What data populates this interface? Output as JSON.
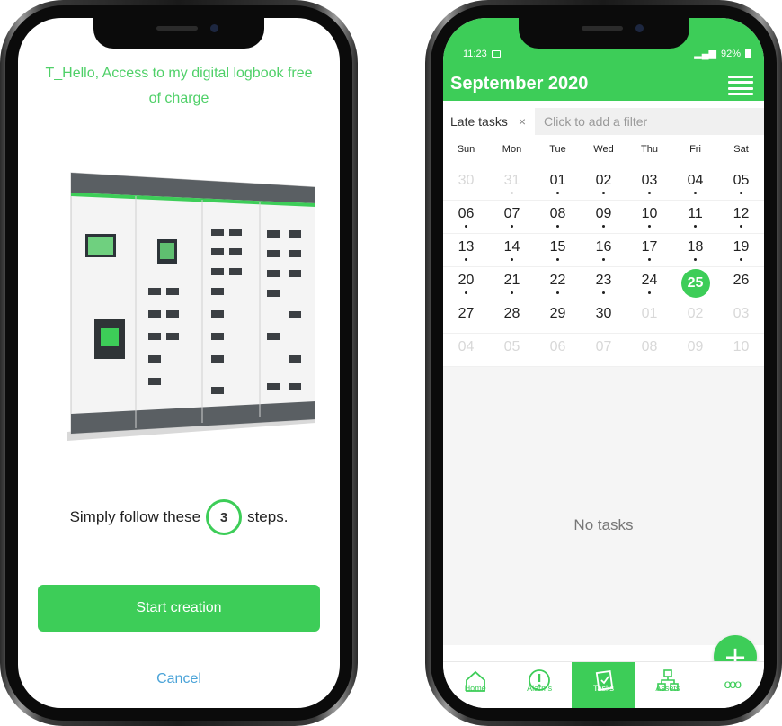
{
  "left_phone": {
    "title": "T_Hello, Access to my digital logbook free of charge",
    "steps_prefix": "Simply follow these",
    "steps_count": "3",
    "steps_suffix": "steps.",
    "start_button": "Start creation",
    "cancel_link": "Cancel"
  },
  "right_phone": {
    "status": {
      "time": "11:23",
      "battery": "92%"
    },
    "header": {
      "month": "September 2020"
    },
    "filter": {
      "chip_label": "Late tasks",
      "chip_close": "×",
      "add_placeholder": "Click to add a filter"
    },
    "weekdays": [
      "Sun",
      "Mon",
      "Tue",
      "Wed",
      "Thu",
      "Fri",
      "Sat"
    ],
    "days": [
      {
        "d": "30",
        "muted": true,
        "dot": false
      },
      {
        "d": "31",
        "muted": true,
        "dot": true
      },
      {
        "d": "01",
        "muted": false,
        "dot": true
      },
      {
        "d": "02",
        "muted": false,
        "dot": true
      },
      {
        "d": "03",
        "muted": false,
        "dot": true
      },
      {
        "d": "04",
        "muted": false,
        "dot": true
      },
      {
        "d": "05",
        "muted": false,
        "dot": true
      },
      {
        "d": "06",
        "muted": false,
        "dot": true
      },
      {
        "d": "07",
        "muted": false,
        "dot": true
      },
      {
        "d": "08",
        "muted": false,
        "dot": true
      },
      {
        "d": "09",
        "muted": false,
        "dot": true
      },
      {
        "d": "10",
        "muted": false,
        "dot": true
      },
      {
        "d": "11",
        "muted": false,
        "dot": true
      },
      {
        "d": "12",
        "muted": false,
        "dot": true
      },
      {
        "d": "13",
        "muted": false,
        "dot": true
      },
      {
        "d": "14",
        "muted": false,
        "dot": true
      },
      {
        "d": "15",
        "muted": false,
        "dot": true
      },
      {
        "d": "16",
        "muted": false,
        "dot": true
      },
      {
        "d": "17",
        "muted": false,
        "dot": true
      },
      {
        "d": "18",
        "muted": false,
        "dot": true
      },
      {
        "d": "19",
        "muted": false,
        "dot": true
      },
      {
        "d": "20",
        "muted": false,
        "dot": true
      },
      {
        "d": "21",
        "muted": false,
        "dot": true
      },
      {
        "d": "22",
        "muted": false,
        "dot": true
      },
      {
        "d": "23",
        "muted": false,
        "dot": true
      },
      {
        "d": "24",
        "muted": false,
        "dot": true
      },
      {
        "d": "25",
        "muted": false,
        "dot": false,
        "today": true
      },
      {
        "d": "26",
        "muted": false,
        "dot": false
      },
      {
        "d": "27",
        "muted": false,
        "dot": false
      },
      {
        "d": "28",
        "muted": false,
        "dot": false
      },
      {
        "d": "29",
        "muted": false,
        "dot": false
      },
      {
        "d": "30",
        "muted": false,
        "dot": false
      },
      {
        "d": "01",
        "muted": true,
        "dot": false
      },
      {
        "d": "02",
        "muted": true,
        "dot": false
      },
      {
        "d": "03",
        "muted": true,
        "dot": false
      },
      {
        "d": "04",
        "muted": true,
        "dot": false
      },
      {
        "d": "05",
        "muted": true,
        "dot": false
      },
      {
        "d": "06",
        "muted": true,
        "dot": false
      },
      {
        "d": "07",
        "muted": true,
        "dot": false
      },
      {
        "d": "08",
        "muted": true,
        "dot": false
      },
      {
        "d": "09",
        "muted": true,
        "dot": false
      },
      {
        "d": "10",
        "muted": true,
        "dot": false
      }
    ],
    "empty_message": "No tasks",
    "fab_label": "+",
    "nav": [
      {
        "label": "Home",
        "icon": "home-icon"
      },
      {
        "label": "Alarms",
        "icon": "alarm-icon"
      },
      {
        "label": "Tasks",
        "icon": "tasks-icon",
        "active": true
      },
      {
        "label": "Assets",
        "icon": "assets-icon"
      },
      {
        "label": "",
        "icon": "more-icon"
      }
    ]
  },
  "colors": {
    "brand_green": "#3dcd58",
    "link_blue": "#4aa3d8",
    "muted_text": "#d8d8d8"
  }
}
